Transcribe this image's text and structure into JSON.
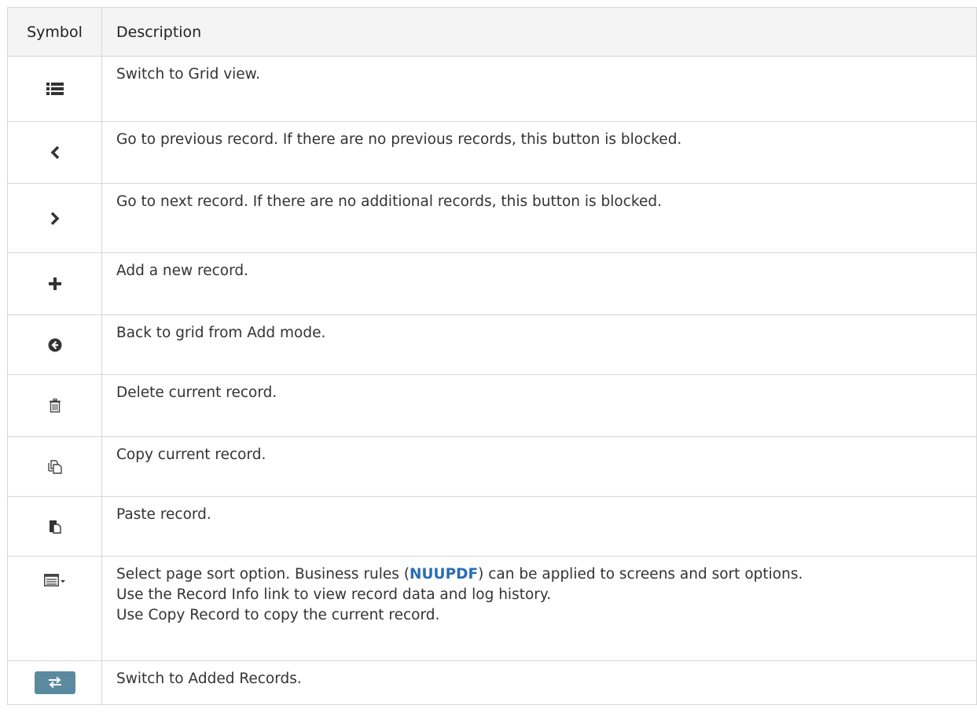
{
  "table": {
    "headers": {
      "symbol": "Symbol",
      "description": "Description"
    },
    "rows": [
      {
        "icon": "grid-view-icon",
        "description": "Switch to Grid view."
      },
      {
        "icon": "chevron-left-icon",
        "description": "Go to previous record. If there are no previous records, this button is blocked."
      },
      {
        "icon": "chevron-right-icon",
        "description": "Go to next record. If there are no additional records, this button is blocked."
      },
      {
        "icon": "plus-icon",
        "description": "Add a new record."
      },
      {
        "icon": "back-circle-icon",
        "description": "Back to grid from Add mode."
      },
      {
        "icon": "trash-icon",
        "description": "Delete current record."
      },
      {
        "icon": "copy-icon",
        "description": "Copy current record."
      },
      {
        "icon": "paste-icon",
        "description": "Paste record."
      },
      {
        "icon": "sort-menu-icon",
        "description_part1": "Select page sort option. Business rules (",
        "link": "NUUPDF",
        "description_part2": ") can be applied to screens and sort options.",
        "description_line2": "Use the Record Info link to view record data and log history.",
        "description_line3": "Use Copy Record to copy the current record."
      },
      {
        "icon": "switch-arrows-icon",
        "description": "Switch to Added Records."
      }
    ]
  },
  "colors": {
    "icon": "#333333",
    "link": "#2a6db5",
    "switch_button": "#5b8aa0",
    "border": "#d6d6d6",
    "header_bg": "#f4f4f4"
  }
}
